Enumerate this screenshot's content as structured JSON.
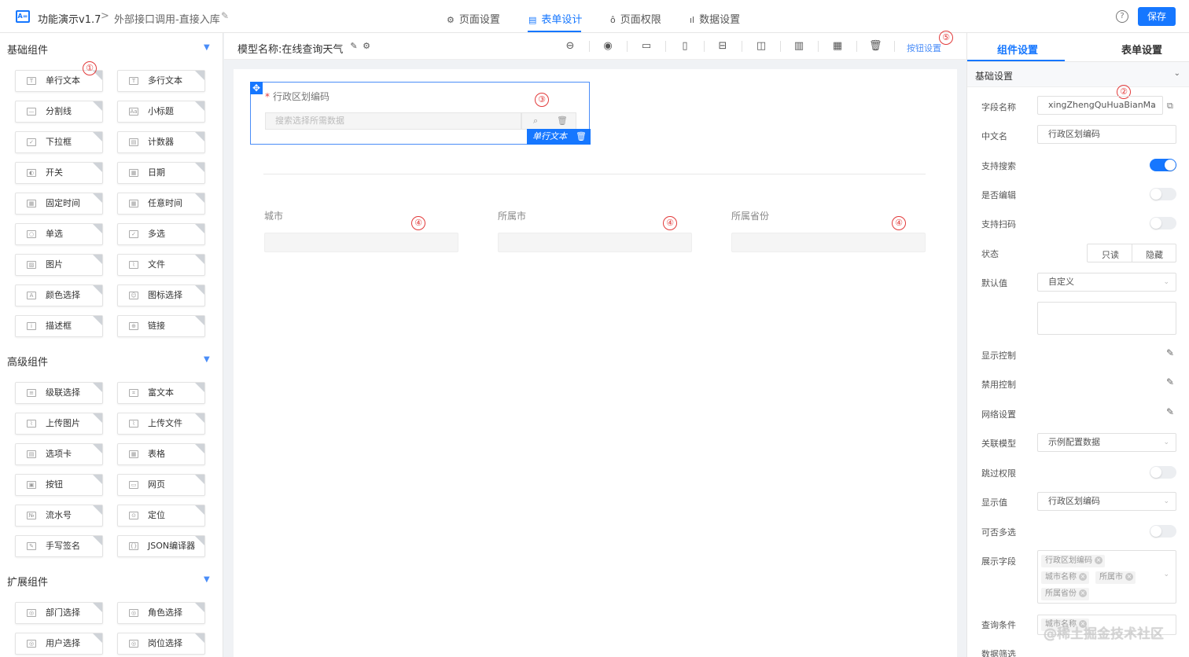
{
  "header": {
    "app_title": "功能演示v1.7",
    "breadcrumb_sep": ">",
    "breadcrumb": "外部接口调用-直接入库",
    "tabs": [
      {
        "label": "页面设置",
        "icon": "gear-icon"
      },
      {
        "label": "表单设计",
        "icon": "document-icon"
      },
      {
        "label": "页面权限",
        "icon": "lock-icon"
      },
      {
        "label": "数据设置",
        "icon": "bar-chart-icon"
      }
    ],
    "help_label": "?",
    "save_label": "保存"
  },
  "left": {
    "basic_title": "基础组件",
    "basic": [
      "单行文本",
      "多行文本",
      "分割线",
      "小标题",
      "下拉框",
      "计数器",
      "开关",
      "日期",
      "固定时间",
      "任意时间",
      "单选",
      "多选",
      "图片",
      "文件",
      "颜色选择",
      "图标选择",
      "描述框",
      "链接"
    ],
    "advanced_title": "高级组件",
    "advanced": [
      "级联选择",
      "富文本",
      "上传图片",
      "上传文件",
      "选项卡",
      "表格",
      "按钮",
      "网页",
      "流水号",
      "定位",
      "手写签名",
      "JSON编译器"
    ],
    "ext_title": "扩展组件",
    "ext": [
      "部门选择",
      "角色选择",
      "用户选择",
      "岗位选择"
    ]
  },
  "center": {
    "model_name": "模型名称:在线查询天气",
    "button_settings": "按钮设置",
    "field_label": "行政区划编码",
    "field_placeholder": "搜索选择所需数据",
    "field_tag": "单行文本",
    "sub_fields": [
      "城市",
      "所属市",
      "所属省份"
    ]
  },
  "annotations": [
    "①",
    "②",
    "③",
    "④",
    "④",
    "④",
    "⑤"
  ],
  "right": {
    "tab_component": "组件设置",
    "tab_form": "表单设置",
    "section": "基础设置",
    "field_name_label": "字段名称",
    "field_name_value": "xingZhengQuHuaBianMa",
    "cn_name_label": "中文名",
    "cn_name_value": "行政区划编码",
    "search_label": "支持搜索",
    "search_on": true,
    "editable_label": "是否编辑",
    "scan_label": "支持扫码",
    "state_label": "状态",
    "state_options": [
      "只读",
      "隐藏"
    ],
    "default_label": "默认值",
    "default_value": "自定义",
    "display_ctrl_label": "显示控制",
    "disable_ctrl_label": "禁用控制",
    "grid_label": "网络设置",
    "rel_model_label": "关联模型",
    "rel_model_value": "示例配置数据",
    "skip_perm_label": "跳过权限",
    "show_value_label": "显示值",
    "show_value": "行政区划编码",
    "multi_label": "可否多选",
    "show_fields_label": "展示字段",
    "show_fields": [
      "行政区划编码",
      "城市名称",
      "所属市",
      "所属省份"
    ],
    "query_label": "查询条件",
    "query_chip": "城市名称",
    "data_filter_label": "数据筛选"
  },
  "watermark": "@稀土掘金技术社区",
  "colors": {
    "accent": "#1677ff",
    "annotation": "#e23a3a"
  }
}
